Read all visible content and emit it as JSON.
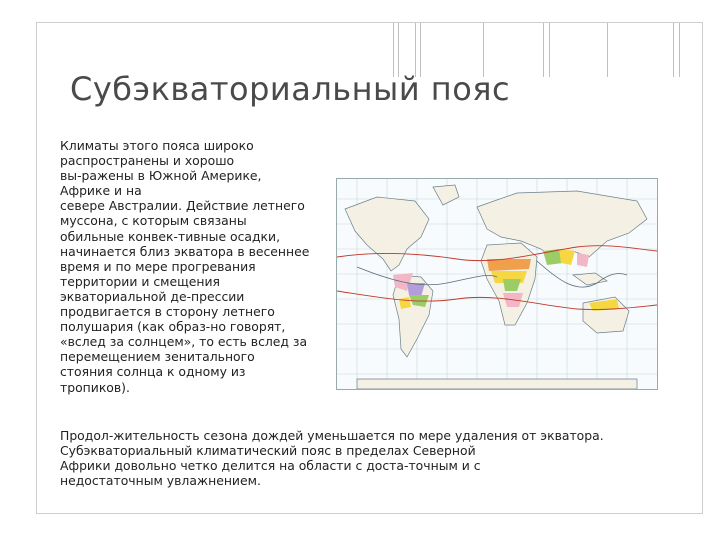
{
  "slide": {
    "title": "Субэкваториальный пояс",
    "paragraph_lines": [
      "Климаты этого пояса широко",
      "распространены и хорошо",
      "вы-ражены в Южной Америке,",
      "Африке и на",
      "севере Австралии. Действие летнего",
      "муссона, с которым связаны",
      "обильные конвек-тивные осадки,",
      "начинается близ экватора в весеннее",
      "время и по мере прогревания",
      "территории и смещения",
      "экваториальной де-прессии",
      "продвигается в сторону летнего",
      "полушария (как образ-но говорят,",
      "«вслед за солнцем», то есть вслед за",
      "перемещением зенитального",
      "стояния солнца к одному из",
      "тропиков)."
    ],
    "continuation_lines": [
      "Продол-жительность сезона дождей уменьшается по мере удаления от экватора.",
      "Субэкваториальный климатический пояс в пределах Северной",
      "Африки довольно четко делится на области с доста-точным и с",
      "недостаточным увлажнением."
    ]
  },
  "map": {
    "icon": "world-climate-map",
    "colors": {
      "land": "#f4f1e4",
      "ocean": "#f7fbfd",
      "grid": "#c9d4da",
      "front_line": "#c0392b",
      "pink": "#f2b6c6",
      "yellow": "#f5d742",
      "green": "#9ccc65",
      "violet": "#b39ddb",
      "orange": "#f0a04b"
    }
  }
}
